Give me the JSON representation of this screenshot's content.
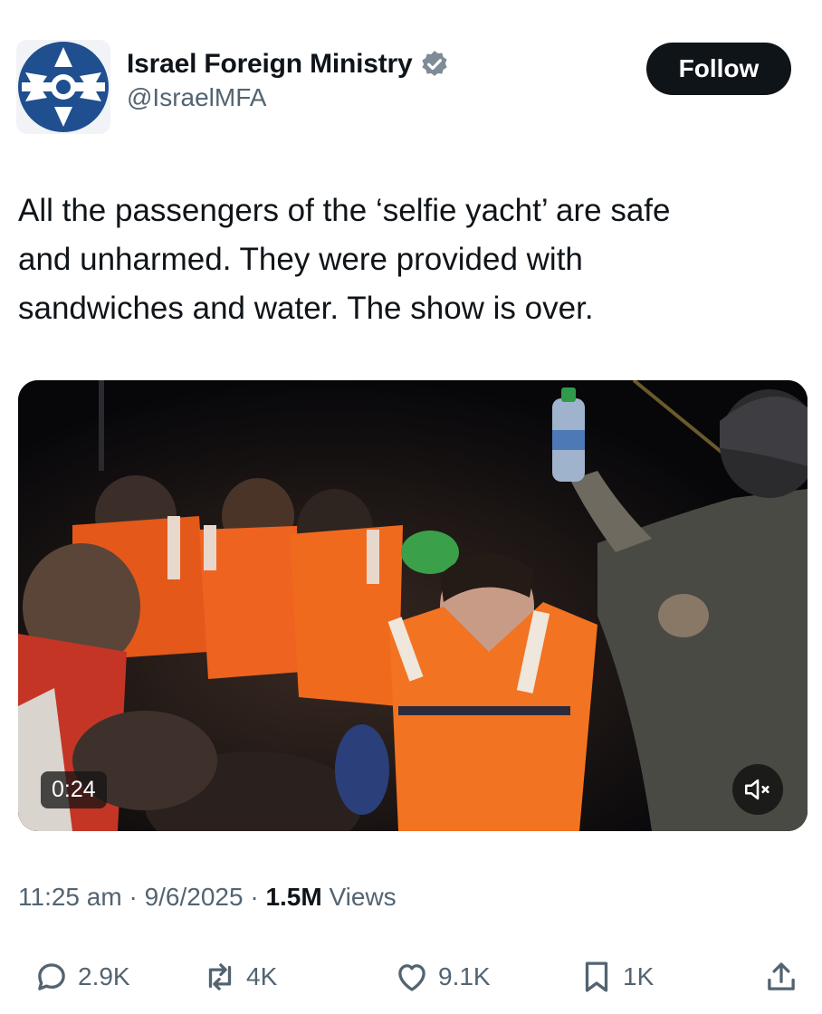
{
  "account": {
    "display_name": "Israel Foreign Ministry",
    "handle": "@IsraelMFA",
    "verified_icon": "verified-badge-icon",
    "follow_label": "Follow"
  },
  "tweet": {
    "text": "All the passengers of the ‘selfie yacht’ are safe\nand unharmed. They were provided with\nsandwiches and water. The show is over."
  },
  "media": {
    "type": "video",
    "duration": "0:24",
    "mute_icon": "muted-speaker-icon"
  },
  "meta": {
    "time": "11:25 am",
    "date": "9/6/2025",
    "separator": "·",
    "views_count": "1.5M",
    "views_label": "Views"
  },
  "actions": {
    "replies": "2.9K",
    "reposts": "4K",
    "likes": "9.1K",
    "bookmarks": "1K"
  },
  "colors": {
    "text": "#0f1419",
    "secondary": "#536471",
    "follow_bg": "#0f1419",
    "logo_blue": "#1f4f8f",
    "vest_orange": "#f26a1b"
  }
}
